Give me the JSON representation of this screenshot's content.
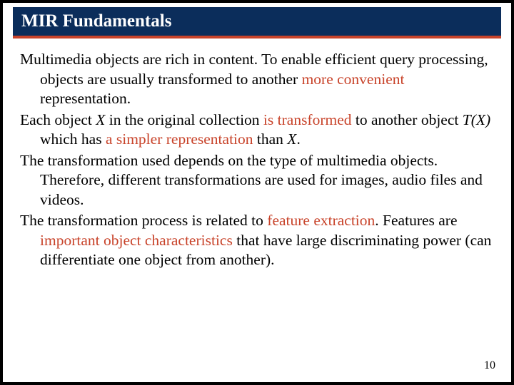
{
  "title": "MIR Fundamentals",
  "p1": {
    "a": "Multimedia objects are rich in content. To enable efficient query processing, objects are usually  transformed to another ",
    "b": "more convenient",
    "c": " representation."
  },
  "p2": {
    "a": "Each object ",
    "b": "X",
    "c": " in the original collection ",
    "d": "is transformed",
    "e": " to another object ",
    "f": "T(X)",
    "g": " which has ",
    "h": "a simpler representation",
    "i": " than ",
    "j": "X",
    "k": "."
  },
  "p3": "The transformation used depends on the type of multimedia objects. Therefore, different transformations are used for images, audio files and videos.",
  "p4": {
    "a": "The transformation process is related to ",
    "b": "feature extraction",
    "c": ". Features are ",
    "d": "important object characteristics",
    "e": " that have large discriminating power (can differentiate one object from another)."
  },
  "page_number": "10"
}
